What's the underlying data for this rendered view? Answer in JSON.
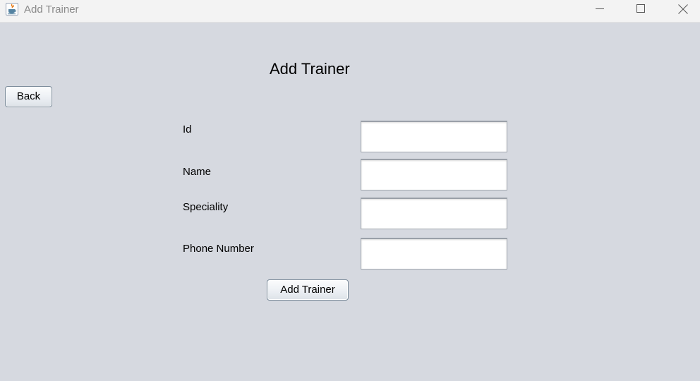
{
  "window": {
    "title": "Add Trainer",
    "app_icon": "java-cup-icon",
    "controls": {
      "minimize": "minimize-icon",
      "maximize": "maximize-icon",
      "close": "close-icon"
    }
  },
  "page": {
    "heading": "Add Trainer",
    "back_label": "Back",
    "submit_label": "Add Trainer"
  },
  "form": {
    "fields": [
      {
        "label": "Id",
        "value": ""
      },
      {
        "label": "Name",
        "value": ""
      },
      {
        "label": "Speciality",
        "value": ""
      },
      {
        "label": "Phone Number",
        "value": ""
      }
    ]
  },
  "colors": {
    "background": "#d6d9e0",
    "titlebar": "#f3f3f3",
    "title_text": "#8a8a8a",
    "input_background": "#ffffff"
  }
}
